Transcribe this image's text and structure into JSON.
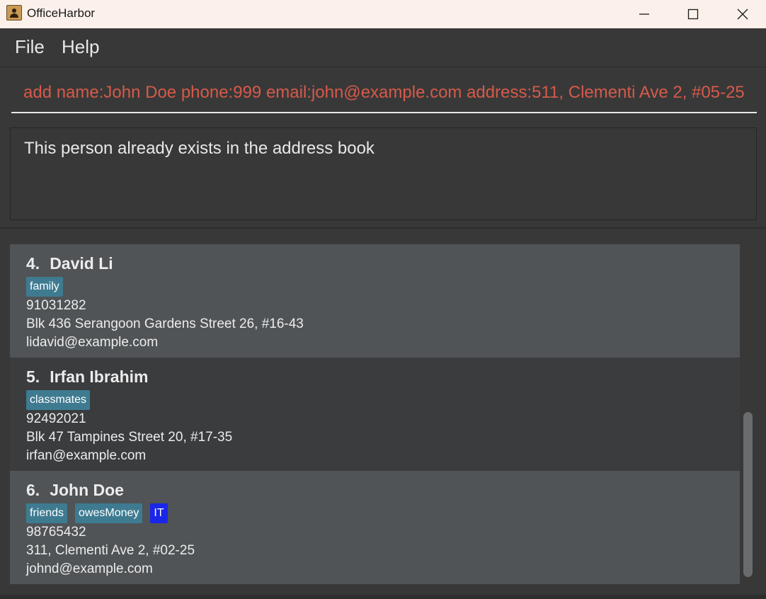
{
  "window": {
    "title": "OfficeHarbor",
    "icon": "address-book-icon"
  },
  "menu": {
    "items": [
      {
        "label": "File"
      },
      {
        "label": "Help"
      }
    ]
  },
  "command": {
    "value": "add name:John Doe phone:999 email:john@example.com address:511, Clementi Ave 2, #05-25",
    "text_color": "#d65a4a"
  },
  "result": {
    "message": "This person already exists in the address book"
  },
  "persons": [
    {
      "index": "4.",
      "name": "David Li",
      "tags": [
        {
          "label": "family",
          "color": "#3e7b91"
        }
      ],
      "phone": "91031282",
      "address": "Blk 436 Serangoon Gardens Street 26, #16-43",
      "email": "lidavid@example.com"
    },
    {
      "index": "5.",
      "name": "Irfan Ibrahim",
      "tags": [
        {
          "label": "classmates",
          "color": "#3e7b91"
        }
      ],
      "phone": "92492021",
      "address": "Blk 47 Tampines Street 20, #17-35",
      "email": "irfan@example.com"
    },
    {
      "index": "6.",
      "name": "John Doe",
      "tags": [
        {
          "label": "friends",
          "color": "#3e7b91"
        },
        {
          "label": "owesMoney",
          "color": "#3e7b91"
        },
        {
          "label": "IT",
          "color": "#1a26e8"
        }
      ],
      "phone": "98765432",
      "address": "311, Clementi Ave 2, #02-25",
      "email": "johnd@example.com"
    }
  ],
  "colors": {
    "background": "#383838",
    "card_even": "#505457",
    "card_odd": "#3b3c3e",
    "tag": "#3e7b91",
    "tag_it": "#1a26e8"
  }
}
